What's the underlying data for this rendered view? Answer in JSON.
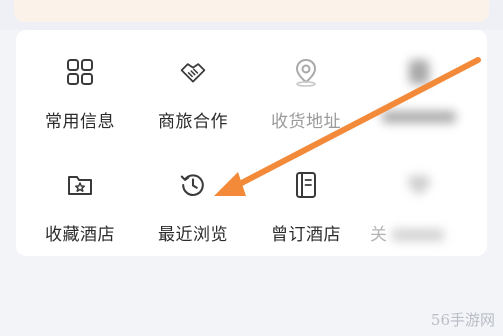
{
  "menu": {
    "row1": [
      {
        "label": "常用信息",
        "icon": "grid-icon"
      },
      {
        "label": "商旅合作",
        "icon": "handshake-icon"
      },
      {
        "label": "收货地址",
        "icon": "location-pin-icon"
      },
      {
        "label": "",
        "icon": "blurred-icon"
      }
    ],
    "row2": [
      {
        "label": "收藏酒店",
        "icon": "folder-star-icon"
      },
      {
        "label": "最近浏览",
        "icon": "history-clock-icon"
      },
      {
        "label": "曾订酒店",
        "icon": "notebook-icon"
      },
      {
        "label": "关",
        "icon": "blurred-heart-icon"
      }
    ]
  },
  "watermark": "56手游网",
  "colors": {
    "arrow": "#f28a3a",
    "icon": "#3a3a3a",
    "top_card": "#fbf2ea"
  }
}
